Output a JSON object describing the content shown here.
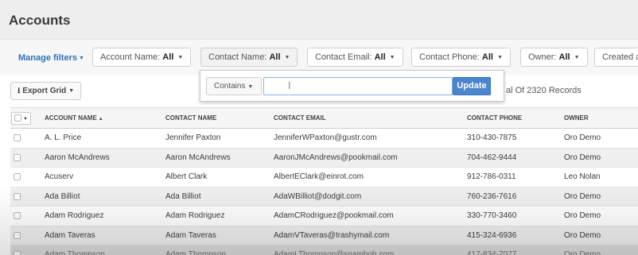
{
  "page": {
    "title": "Accounts"
  },
  "filters": {
    "manage_label": "Manage filters",
    "items": [
      {
        "label": "Account Name:",
        "value": "All"
      },
      {
        "label": "Contact Name:",
        "value": "All"
      },
      {
        "label": "Contact Email:",
        "value": "All"
      },
      {
        "label": "Contact Phone:",
        "value": "All"
      },
      {
        "label": "Owner:",
        "value": "All"
      },
      {
        "label": "Created a",
        "value": ""
      }
    ]
  },
  "popup": {
    "operator": "Contains",
    "value": "",
    "update_label": "Update"
  },
  "toolbar": {
    "export_label": "Export Grid",
    "records_text": "al Of 2320 Records"
  },
  "grid": {
    "columns": [
      "ACCOUNT NAME",
      "CONTACT NAME",
      "CONTACT EMAIL",
      "CONTACT PHONE",
      "OWNER"
    ],
    "sort_column": "ACCOUNT NAME",
    "rows": [
      [
        "A. L. Price",
        "Jennifer Paxton",
        "JenniferWPaxton@gustr.com",
        "310-430-7875",
        "Oro Demo"
      ],
      [
        "Aaron McAndrews",
        "Aaron McAndrews",
        "AaronJMcAndrews@pookmail.com",
        "704-462-9444",
        "Oro Demo"
      ],
      [
        "Acuserv",
        "Albert Clark",
        "AlbertEClark@einrot.com",
        "912-786-0311",
        "Leo Nolan"
      ],
      [
        "Ada Billiot",
        "Ada Billiot",
        "AdaWBilliot@dodgit.com",
        "760-236-7616",
        "Oro Demo"
      ],
      [
        "Adam Rodriguez",
        "Adam Rodriguez",
        "AdamCRodriguez@pookmail.com",
        "330-770-3460",
        "Oro Demo"
      ],
      [
        "Adam Taveras",
        "Adam Taveras",
        "AdamVTaveras@trashymail.com",
        "415-324-6936",
        "Oro Demo"
      ],
      [
        "Adam Thompson",
        "Adam Thompson",
        "AdamLThompson@spambob.com",
        "417-834-7077",
        "Oro Demo"
      ]
    ]
  }
}
